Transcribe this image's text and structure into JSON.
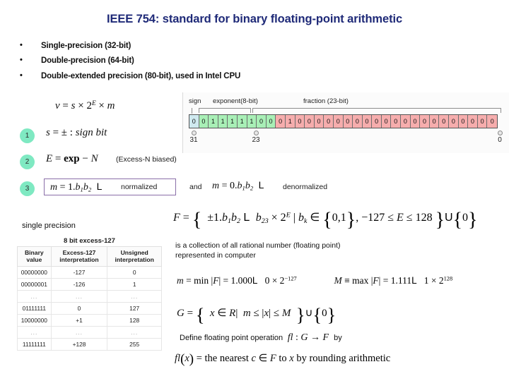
{
  "title": "IEEE 754: standard for binary floating-point arithmetic",
  "bullets": [
    {
      "marker": "•",
      "text": "Single-precision (32-bit)"
    },
    {
      "marker": "•",
      "text": "Double-precision (64-bit)"
    },
    {
      "marker": "•",
      "text": "Double-extended precision (80-bit), used in Intel CPU"
    }
  ],
  "formulas": {
    "value_equation": "v = s × 2^E × m",
    "item1_number": "1",
    "item1_equation": "s = ± : sign bit",
    "item2_number": "2",
    "item2_equation": "E = exp − N",
    "item2_note": "(Excess-N biased)",
    "item3_number": "3",
    "item3_equation": "m = 1.b₁b₂L",
    "item3_label": "normalized",
    "and_word": "and",
    "item3_alt_equation": "m = 0.b₁b₂L",
    "item3_alt_label": "denormalized",
    "single_precision_label": "single precision",
    "set_F": "F = { ±1.b₁b₂L b₂₃ × 2^E | b_k ∈ {0,1}, −127 ≤ E ≤ 128 } U {0}",
    "min_F": "m = min|F| = 1.000L 0 × 2^−127",
    "max_F": "M ≡ max|F| = 1.111L 1 × 2^128",
    "set_G": "G = { x ∈ R | m ≤ |x| ≤ M } U {0}",
    "define_prefix": "Define floating point operation",
    "define_map": "fl : G → F",
    "define_suffix": "by",
    "fl_definition": "fl(x) = the nearest c ∈ F to x by rounding arithmetic"
  },
  "description": {
    "line1": "is a collection of all rational number (floating point)",
    "line2": "represented in computer"
  },
  "bitfield": {
    "sign_label": "sign",
    "exponent_label": "exponent(8-bit)",
    "fraction_label": "fraction (23-bit)",
    "sign_bits": "0",
    "exponent_bits": "01111100",
    "fraction_bits": "01000000000000000000000",
    "index_high": "31",
    "index_mid": "23",
    "index_low": "0",
    "color_sign": "#cfe9ef",
    "color_exponent": "#a8efb6",
    "color_fraction": "#f6adad"
  },
  "excess_table": {
    "caption": "8 bit excess-127",
    "headers": [
      "Binary value",
      "Excess-127 interpretation",
      "Unsigned interpretation"
    ],
    "rows": [
      [
        "00000000",
        "-127",
        "0"
      ],
      [
        "00000001",
        "-126",
        "1"
      ],
      [
        "...",
        "...",
        "..."
      ],
      [
        "01111111",
        "0",
        "127"
      ],
      [
        "10000000",
        "+1",
        "128"
      ],
      [
        "...",
        "...",
        "..."
      ],
      [
        "11111111",
        "+128",
        "255"
      ]
    ]
  },
  "colors": {
    "title": "#1f2a78",
    "badge": "#7fe9c2",
    "box_border": "#8a6ea8"
  }
}
